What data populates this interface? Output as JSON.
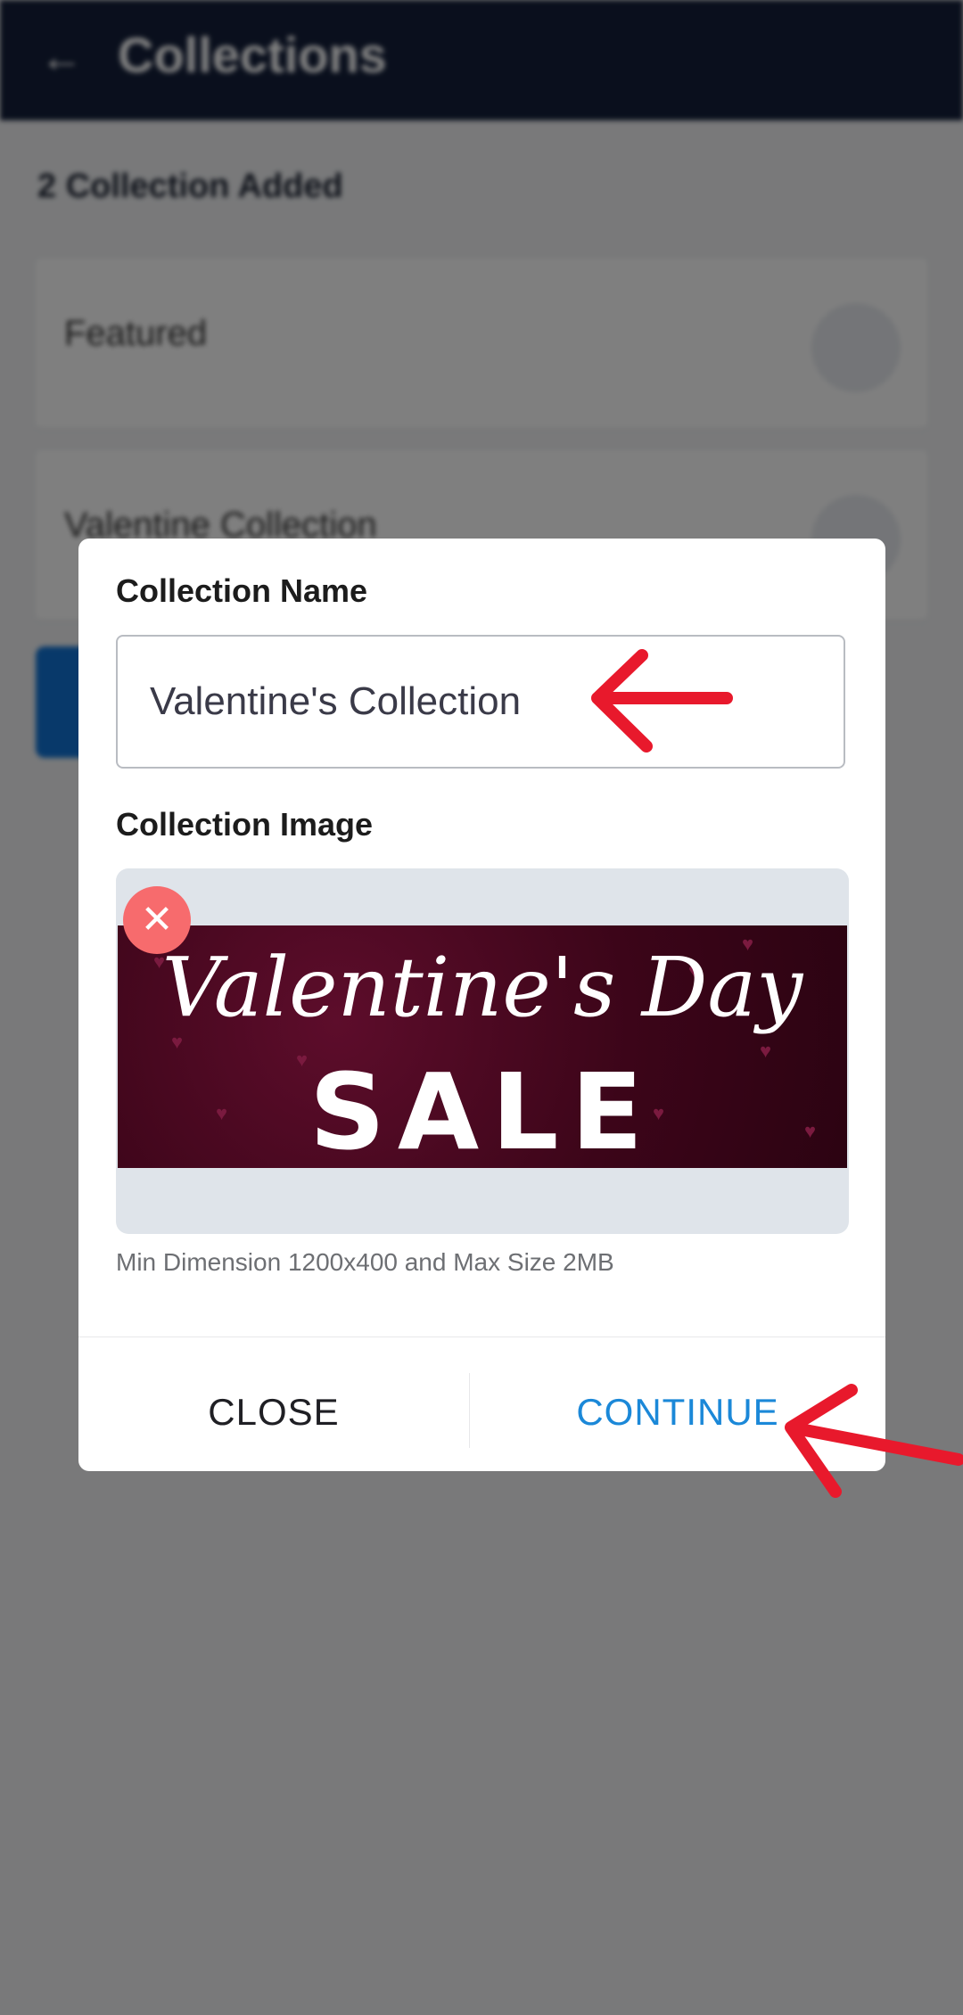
{
  "appbar": {
    "title": "Collections",
    "back_icon": "back-arrow-icon"
  },
  "page": {
    "count_text": "2 Collection Added",
    "cards": [
      {
        "name": "Featured"
      },
      {
        "name": "Valentine Collection"
      }
    ]
  },
  "dialog": {
    "name_label": "Collection Name",
    "name_value": "Valentine's Collection",
    "image_label": "Collection Image",
    "banner": {
      "line1": "Valentine's Day",
      "line2": "SALE"
    },
    "hint": "Min Dimension 1200x400 and Max Size 2MB",
    "close_label": "CLOSE",
    "continue_label": "CONTINUE"
  },
  "colors": {
    "appbar": "#141f3a",
    "accent": "#1b88d8",
    "remove": "#f76b6d",
    "annotation": "#e8192c"
  }
}
